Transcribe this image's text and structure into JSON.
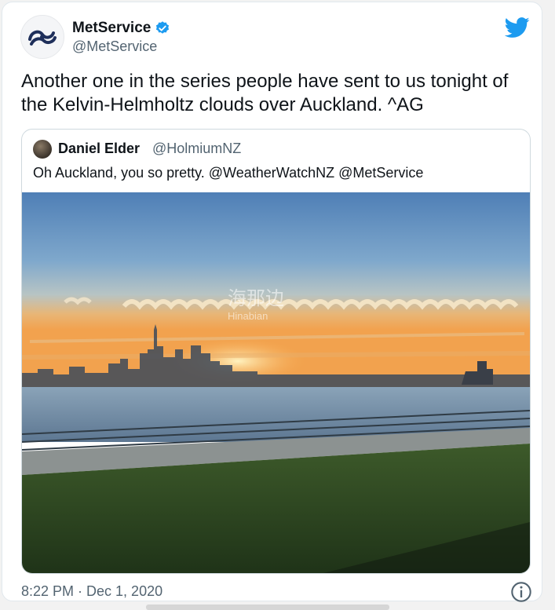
{
  "tweet": {
    "author_name": "MetService",
    "author_handle": "@MetService",
    "text": "Another one in the series people have sent to us tonight of the Kelvin-Helmholtz clouds over Auckland. ^AG",
    "timestamp": "8:22 PM · Dec 1, 2020"
  },
  "quoted_tweet": {
    "author_name": "Daniel Elder",
    "author_handle": "@HolmiumNZ",
    "text": "Oh Auckland, you so pretty. @WeatherWatchNZ @MetService"
  },
  "watermark": {
    "text_cn": "海那边",
    "text_en": "Hinabian"
  },
  "icons": {
    "verified": "verified-badge-icon",
    "brand": "twitter-bird-icon",
    "info": "info-icon",
    "avatar": "metservice-logo"
  },
  "colors": {
    "twitter_blue": "#1d9bf0",
    "text_primary": "#0f1419",
    "text_secondary": "#536471",
    "border": "#cfd9de"
  }
}
